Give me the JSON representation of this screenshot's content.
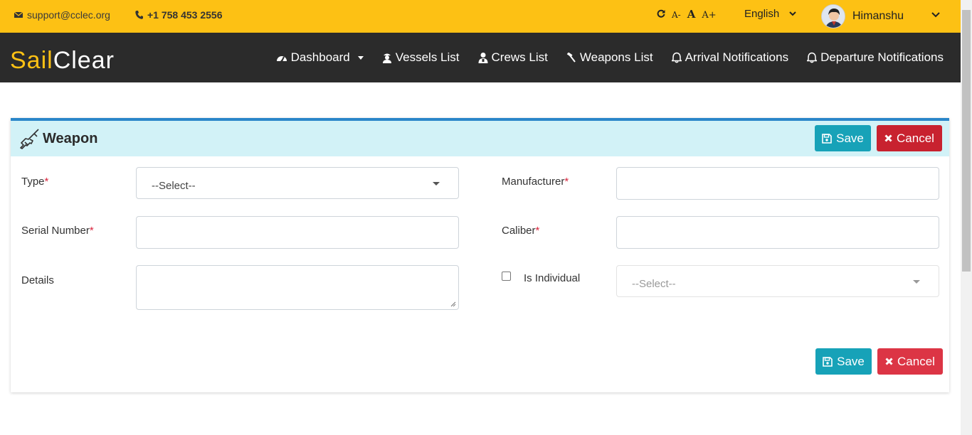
{
  "topbar": {
    "email": "support@cclec.org",
    "phone": "+1 758 453 2556",
    "font_controls": [
      "A-",
      "A",
      "A+"
    ],
    "language": "English",
    "username": "Himanshu"
  },
  "navbar": {
    "logo_part1": "Sail",
    "logo_part2": "Clear",
    "items": [
      {
        "label": "Dashboard",
        "icon": "dashboard-icon"
      },
      {
        "label": "Vessels List",
        "icon": "captain-icon"
      },
      {
        "label": "Crews List",
        "icon": "user-icon"
      },
      {
        "label": "Weapons List",
        "icon": "hammer-icon"
      },
      {
        "label": "Arrival Notifications",
        "icon": "bell-icon"
      },
      {
        "label": "Departure Notifications",
        "icon": "bell-icon"
      }
    ]
  },
  "form": {
    "title": "Weapon",
    "save_label": "Save",
    "cancel_label": "Cancel",
    "type_label": "Type",
    "type_value": "--Select--",
    "manufacturer_label": "Manufacturer",
    "manufacturer_value": "",
    "serial_label": "Serial Number",
    "serial_value": "",
    "caliber_label": "Caliber",
    "caliber_value": "",
    "details_label": "Details",
    "details_value": "",
    "individual_label": "Is Individual",
    "individual_checked": false,
    "individual_select_value": "--Select--",
    "required_mark": "*"
  },
  "colors": {
    "topbar": "#fdc114",
    "navbar": "#2b2b2b",
    "save": "#17a2b8",
    "cancel": "#dc3545",
    "header_bg": "#d2f2f7",
    "card_accent": "#2a86c9"
  }
}
